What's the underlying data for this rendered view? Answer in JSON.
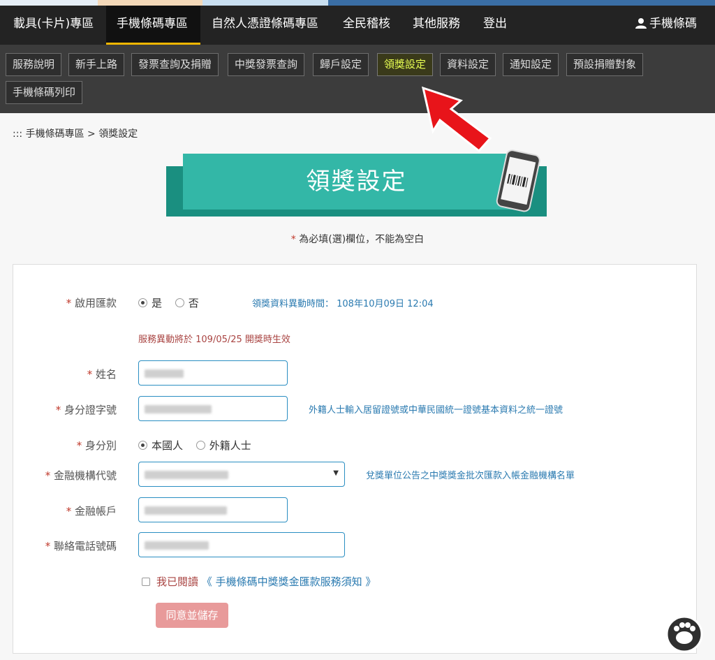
{
  "nav": {
    "items": [
      "載具(卡片)專區",
      "手機條碼專區",
      "自然人憑證條碼專區",
      "全民稽核",
      "其他服務",
      "登出"
    ],
    "active_index": 1,
    "user_label": "手機條碼"
  },
  "subnav": {
    "items": [
      "服務說明",
      "新手上路",
      "發票查詢及捐贈",
      "中獎發票查詢",
      "歸戶設定",
      "領獎設定",
      "資料設定",
      "通知設定",
      "預設捐贈對象",
      "手機條碼列印"
    ],
    "active_index": 5
  },
  "breadcrumb": "::: 手機條碼專區 > 領獎設定",
  "banner_title": "領獎設定",
  "required_note": "為必填(選)欄位，不能為空白",
  "form": {
    "enable": {
      "label": "啟用匯款",
      "options": [
        "是",
        "否"
      ],
      "selected": "是",
      "updated_text": "領獎資料異動時間： 108年10月09日 12:04"
    },
    "notice": "服務異動將於 109/05/25 開獎時生效",
    "name": {
      "label": "姓名"
    },
    "id_no": {
      "label": "身分證字號",
      "hint": "外籍人士輸入居留證號或中華民國統一證號基本資料之統一證號"
    },
    "identity": {
      "label": "身分別",
      "options": [
        "本國人",
        "外籍人士"
      ],
      "selected": "本國人"
    },
    "bank_code": {
      "label": "金融機構代號",
      "hint": "兌獎單位公告之中獎獎金批次匯款入帳金融機構名單"
    },
    "account": {
      "label": "金融帳戶"
    },
    "phone": {
      "label": "聯絡電話號碼"
    },
    "agree": {
      "read_label": "我已閱讀",
      "link_label": "《 手機條碼中獎獎金匯款服務須知 》"
    },
    "submit_label": "同意並儲存"
  },
  "colors": {
    "banner": "#33b7a7",
    "active_tab": "#e8ff52",
    "link": "#2a7ab0",
    "warning": "#a94442",
    "submit": "#e89a9a"
  }
}
